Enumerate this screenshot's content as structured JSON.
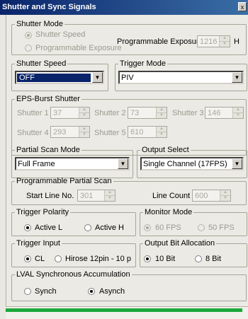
{
  "window": {
    "title": "Shutter and Sync Signals",
    "close_glyph": "x"
  },
  "shutter_mode": {
    "legend": "Shutter Mode",
    "option_speed": "Shutter Speed",
    "option_exposure": "Programmable Exposure",
    "selected": "Shutter Speed",
    "prog_exposure_label": "Programmable Exposure",
    "prog_exposure_value": "1216",
    "prog_exposure_unit": "H"
  },
  "shutter_speed": {
    "legend": "Shutter Speed",
    "value": "OFF"
  },
  "trigger_mode": {
    "legend": "Trigger Mode",
    "value": "PIV"
  },
  "eps_burst": {
    "legend": "EPS-Burst Shutter",
    "shutters": [
      {
        "label": "Shutter 1",
        "value": "37"
      },
      {
        "label": "Shutter 2",
        "value": "73"
      },
      {
        "label": "Shutter 3",
        "value": "146"
      },
      {
        "label": "Shutter 4",
        "value": "293"
      },
      {
        "label": "Shutter 5",
        "value": "610"
      }
    ]
  },
  "partial_scan_mode": {
    "legend": "Partial Scan Mode",
    "value": "Full Frame"
  },
  "output_select": {
    "legend": "Output Select",
    "value": "Single Channel (17FPS)"
  },
  "prog_partial_scan": {
    "legend": "Programmable Partial Scan",
    "start_label": "Start Line No.",
    "start_value": "301",
    "count_label": "Line Count",
    "count_value": "600"
  },
  "trigger_polarity": {
    "legend": "Trigger Polarity",
    "option_l": "Active L",
    "option_h": "Active H",
    "selected": "Active L"
  },
  "monitor_mode": {
    "legend": "Monitor Mode",
    "option_60": "60 FPS",
    "option_50": "50 FPS",
    "selected": "60 FPS"
  },
  "trigger_input": {
    "legend": "Trigger Input",
    "option_cl": "CL",
    "option_hirose": "Hirose 12pin - 10 p",
    "selected": "CL"
  },
  "output_bit": {
    "legend": "Output Bit Allocation",
    "option_10": "10 Bit",
    "option_8": "8 Bit",
    "selected": "10 Bit"
  },
  "lval": {
    "legend": "LVAL Synchronous Accumulation",
    "option_synch": "Synch",
    "option_asynch": "Asynch",
    "selected": "Asynch"
  },
  "status": {
    "progress_fraction": 1.0,
    "progress_color": "#1da83c"
  },
  "colors": {
    "title_bar": "#0a246a",
    "selection": "#0a246a",
    "panel": "#ebeae4"
  }
}
